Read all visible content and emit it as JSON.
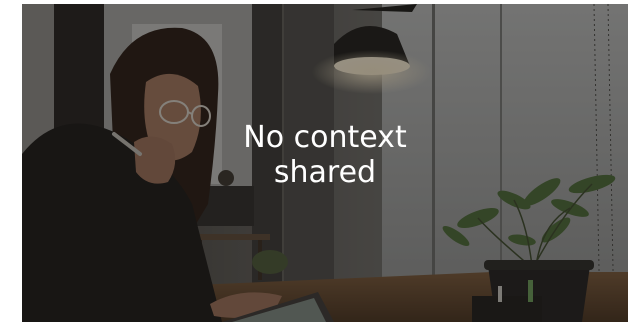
{
  "overlay": {
    "message_line_1": "No context",
    "message_line_2": "shared"
  },
  "colors": {
    "overlay_text": "#ffffff",
    "page_background": "#ffffff"
  }
}
